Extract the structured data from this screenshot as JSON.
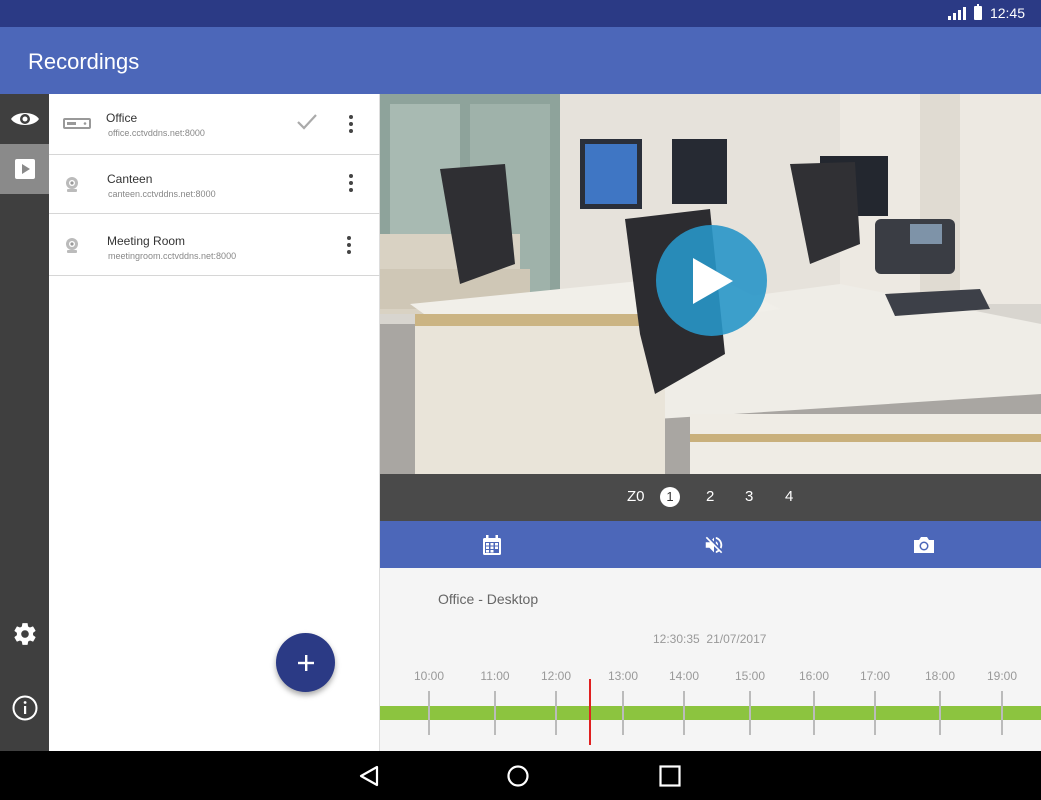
{
  "status_bar": {
    "time": "12:45"
  },
  "app_bar": {
    "title": "Recordings"
  },
  "nav_rail": {
    "items": [
      {
        "icon": "eye-icon",
        "active": false
      },
      {
        "icon": "play-box-icon",
        "active": true
      },
      {
        "icon": "gear-icon",
        "active": false
      },
      {
        "icon": "info-icon",
        "active": false
      }
    ]
  },
  "devices": [
    {
      "name": "Office",
      "address": "office.cctvddns.net:8000",
      "icon": "dvr-icon",
      "selected": true
    },
    {
      "name": "Canteen",
      "address": "canteen.cctvddns.net:8000",
      "icon": "camera-icon",
      "selected": false
    },
    {
      "name": "Meeting Room",
      "address": "meetingroom.cctvddns.net:8000",
      "icon": "camera-icon",
      "selected": false
    }
  ],
  "fab": {
    "icon": "plus-icon"
  },
  "camera_bar": {
    "items": [
      "Z0",
      "1",
      "2",
      "3",
      "4"
    ],
    "selected": "1"
  },
  "action_bar": {
    "icons": [
      "calendar-icon",
      "mute-icon",
      "camera-snapshot-icon"
    ]
  },
  "timeline": {
    "title": "Office - Desktop",
    "time": "12:30:35",
    "date": "21/07/2017",
    "hours": [
      "10:00",
      "11:00",
      "12:00",
      "13:00",
      "14:00",
      "15:00",
      "16:00",
      "17:00",
      "18:00",
      "19:00"
    ],
    "bar_color": "#8cc43f",
    "cursor_color": "#e02020"
  },
  "colors": {
    "primary": "#4c67b9",
    "primary_dark": "#2b3a85",
    "accent_play": "#2896c8"
  }
}
